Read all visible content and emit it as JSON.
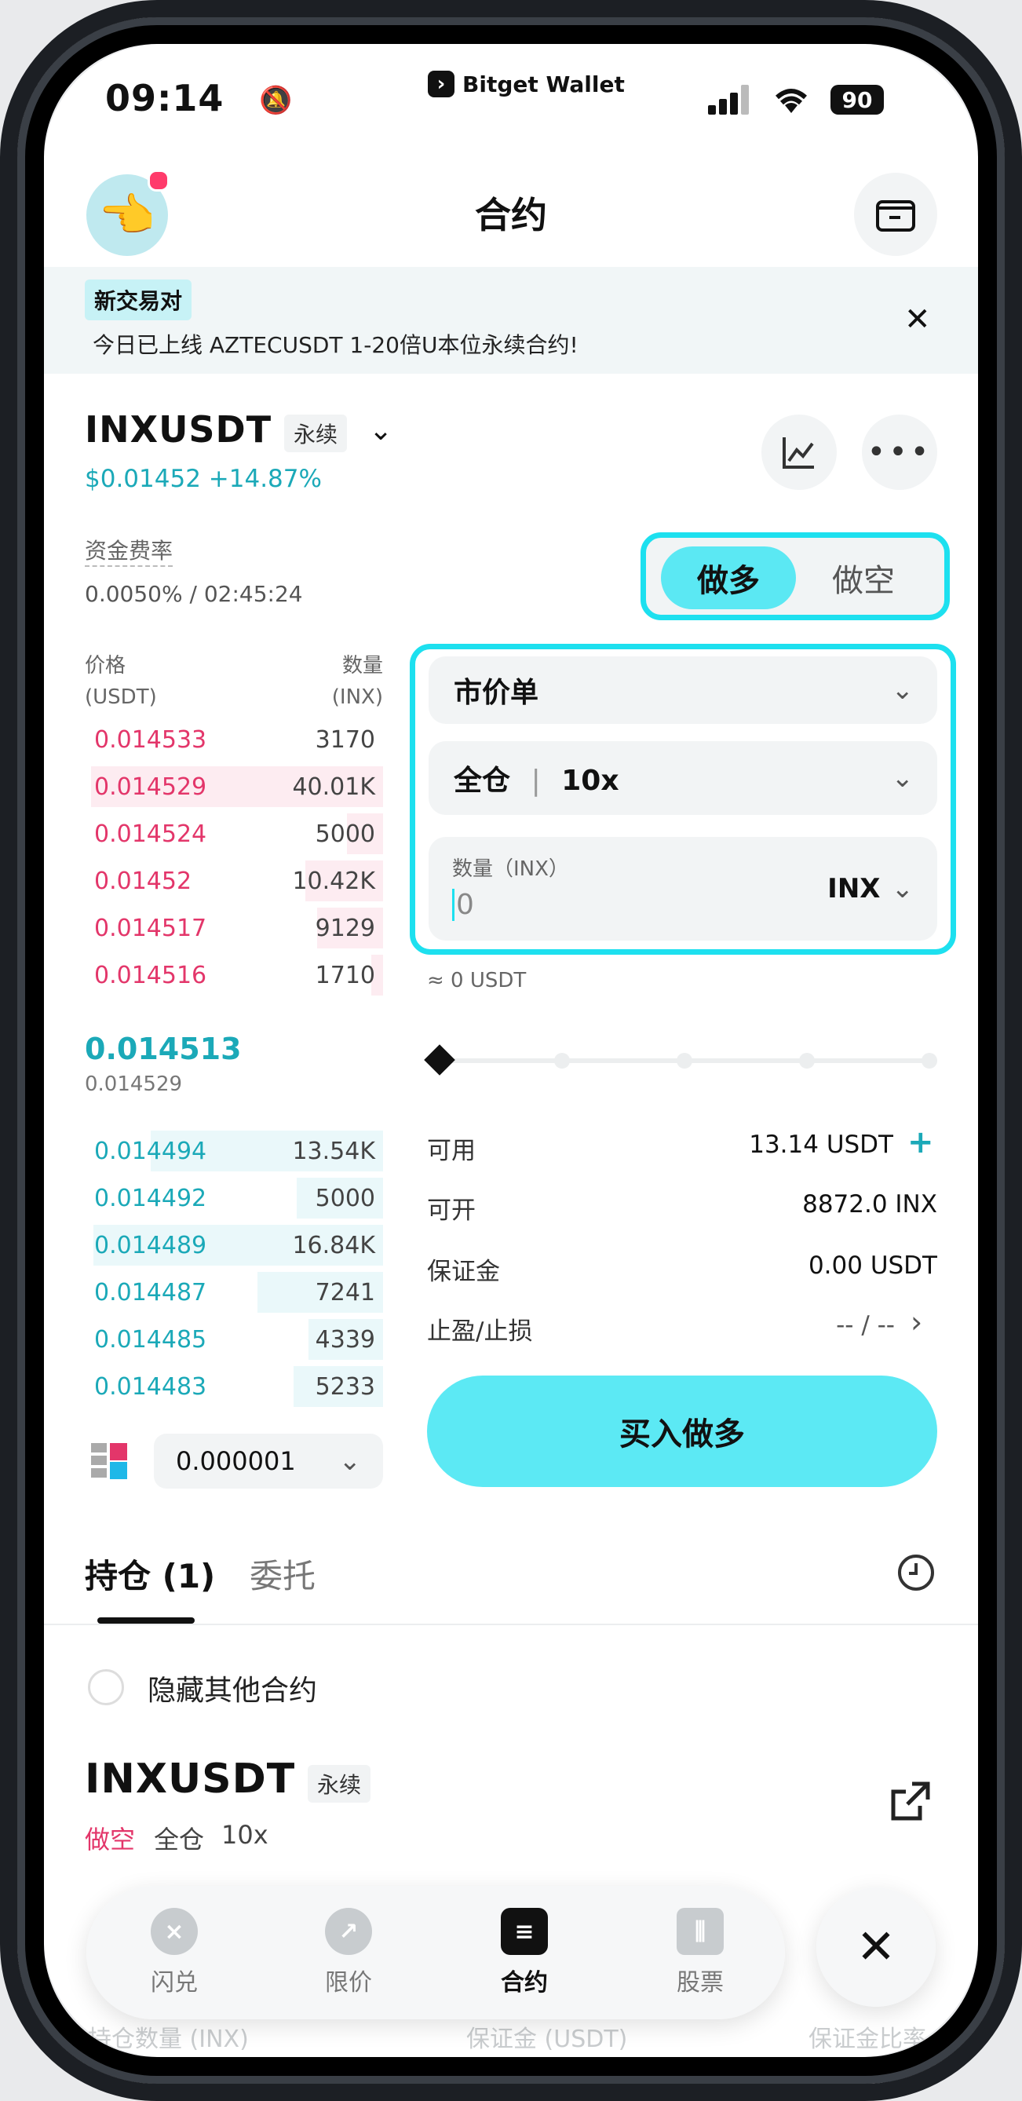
{
  "status": {
    "time": "09:14",
    "brand": "Bitget Wallet",
    "battery": "90"
  },
  "header": {
    "title": "合约"
  },
  "banner": {
    "tag": "新交易对",
    "text": "今日已上线 AZTECUSDT 1-20倍U本位永续合约!"
  },
  "pair": {
    "symbol": "INXUSDT",
    "type": "永续",
    "price_change": "$0.01452 +14.87%"
  },
  "funding": {
    "label": "资金费率",
    "value": "0.0050% / 02:45:24"
  },
  "side": {
    "long": "做多",
    "short": "做空"
  },
  "orderbook": {
    "price_header": "价格\n(USDT)",
    "price_header_l1": "价格",
    "price_header_l2": "(USDT)",
    "qty_header_l1": "数量",
    "qty_header_l2": "(INX)",
    "asks": [
      {
        "price": "0.014533",
        "qty": "3170",
        "depth": 0
      },
      {
        "price": "0.014529",
        "qty": "40.01K",
        "depth": 0.98
      },
      {
        "price": "0.014524",
        "qty": "5000",
        "depth": 0.12
      },
      {
        "price": "0.01452",
        "qty": "10.42K",
        "depth": 0.26
      },
      {
        "price": "0.014517",
        "qty": "9129",
        "depth": 0.22
      },
      {
        "price": "0.014516",
        "qty": "1710",
        "depth": 0.04
      }
    ],
    "mid_price": "0.014513",
    "mark_price": "0.014529",
    "bids": [
      {
        "price": "0.014494",
        "qty": "13.54K",
        "depth": 0.78
      },
      {
        "price": "0.014492",
        "qty": "5000",
        "depth": 0.29
      },
      {
        "price": "0.014489",
        "qty": "16.84K",
        "depth": 0.97
      },
      {
        "price": "0.014487",
        "qty": "7241",
        "depth": 0.42
      },
      {
        "price": "0.014485",
        "qty": "4339",
        "depth": 0.25
      },
      {
        "price": "0.014483",
        "qty": "5233",
        "depth": 0.3
      }
    ],
    "precision": "0.000001"
  },
  "order": {
    "order_type": "市价单",
    "margin_mode": "全仓",
    "leverage": "10x",
    "qty_label": "数量（INX）",
    "qty_value": "0",
    "qty_unit": "INX",
    "approx": "≈ 0 USDT",
    "slider_value": 0,
    "available_label": "可用",
    "available_value": "13.14 USDT",
    "openable_label": "可开",
    "openable_value": "8872.0 INX",
    "margin_label": "保证金",
    "margin_value": "0.00 USDT",
    "tpsl_label": "止盈/止损",
    "tpsl_value": "-- / --",
    "submit": "买入做多"
  },
  "tabs": {
    "positions": "持仓 (1)",
    "orders": "委托"
  },
  "filter": {
    "hide_other": "隐藏其他合约"
  },
  "position": {
    "symbol": "INXUSDT",
    "type": "永续",
    "side": "做空",
    "mode": "全仓",
    "leverage": "10x",
    "col1": "持仓数量 (INX)",
    "col2": "保证金 (USDT)",
    "col3": "保证金比率"
  },
  "nav": {
    "swap": "闪兑",
    "limit": "限价",
    "futures": "合约",
    "stocks": "股票"
  },
  "colors": {
    "accent": "#5ce9f4",
    "ask": "#e3366a",
    "bid": "#1ba9b8",
    "highlight": "#1de0ef"
  }
}
